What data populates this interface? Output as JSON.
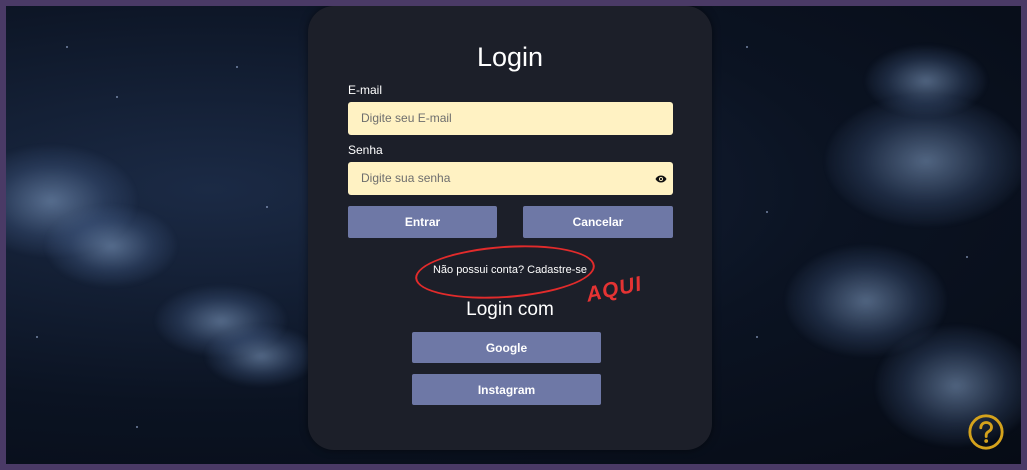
{
  "login": {
    "title": "Login",
    "email_label": "E-mail",
    "email_placeholder": "Digite seu E-mail",
    "password_label": "Senha",
    "password_placeholder": "Digite sua senha",
    "submit_label": "Entrar",
    "cancel_label": "Cancelar",
    "signup_text": "Não possui conta? Cadastre-se",
    "annotation_text": "AQUI",
    "social_title": "Login com",
    "google_label": "Google",
    "instagram_label": "Instagram"
  },
  "icons": {
    "password_toggle": "eye-icon",
    "help": "help-icon"
  },
  "colors": {
    "card_background": "#1c1f29",
    "input_background": "#fff2c3",
    "button": "#6e78a6",
    "annotation": "#e53333",
    "help_icon": "#d4a21c",
    "frame": "#4a3a66"
  }
}
